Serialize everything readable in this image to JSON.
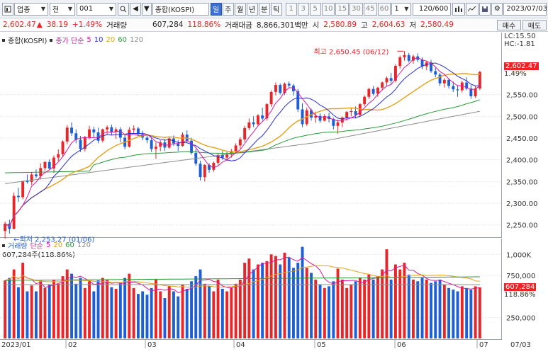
{
  "toolbar": {
    "category": "업종",
    "type": "전",
    "code": "001",
    "name": "종합(KOSPI)",
    "periods": [
      "일",
      "주",
      "월",
      "년",
      "분",
      "틱"
    ],
    "active_period": "일",
    "minutes": [
      "1",
      "3",
      "5",
      "10",
      "15",
      "30",
      "45",
      "60"
    ],
    "unit": "1",
    "count": "120/600",
    "date": "2023/07/03"
  },
  "quote": {
    "price": "2,602.47",
    "change": "38.19",
    "rate": "+1.49%",
    "volume_label": "거래량",
    "volume": "607,284",
    "volume_rate": "118.86%",
    "amount_label": "거래대금",
    "amount": "8,866,301백만",
    "open_label": "시",
    "open": "2,580.89",
    "high_label": "고",
    "high": "2,604.63",
    "low_label": "저",
    "low": "2,580.49",
    "buy": "매수",
    "sell": "매도"
  },
  "price_panel": {
    "title": "종합(KOSPI)",
    "ma_label": "종가 단순",
    "ma_periods": [
      "5",
      "10",
      "20",
      "60",
      "120"
    ],
    "lc": "LC:15.50",
    "hc": "HC:-1.81",
    "last_price": "2,602.47",
    "last_rate": "1.49%",
    "high_annotation": "최고 2,650.45 (06/12)",
    "low_annotation": "최저 2,253.27 (01/06)",
    "y_ticks": [
      "2,550.00",
      "2,500.00",
      "2,450.00",
      "2,400.00",
      "2,350.00",
      "2,300.00",
      "2,250.00"
    ]
  },
  "volume_panel": {
    "title": "거래량",
    "ma_label": "단순",
    "ma_periods": [
      "5",
      "20",
      "60",
      "120"
    ],
    "last_value_text": "607,284주(118.86%)",
    "tag_value": "607,284",
    "tag_rate": "118.86%",
    "y_ticks": [
      "1,000K",
      "750,000",
      "250,000"
    ]
  },
  "x_labels": [
    "2023/01",
    "02",
    "03",
    "04",
    "05",
    "06",
    "07",
    "07/03"
  ],
  "colors": {
    "up": "#e8262a",
    "down": "#1f5fd6",
    "ma5": "#d81b9c",
    "ma10": "#2a2fd0",
    "ma20": "#e3a21a",
    "ma60": "#2a9a3a",
    "ma120": "#8c8c8c"
  },
  "chart_data": {
    "type": "candlestick",
    "title": "종합(KOSPI)",
    "y_range": [
      2230,
      2670
    ],
    "volume_range": [
      0,
      1120000
    ],
    "series_key": [
      "o",
      "h",
      "l",
      "c",
      "v"
    ],
    "candles": [
      [
        2236,
        2258,
        2218,
        2253,
        690000
      ],
      [
        2253,
        2262,
        2230,
        2241,
        720000
      ],
      [
        2241,
        2325,
        2240,
        2317,
        820000
      ],
      [
        2317,
        2336,
        2303,
        2314,
        610000
      ],
      [
        2314,
        2352,
        2309,
        2351,
        900000
      ],
      [
        2351,
        2366,
        2345,
        2349,
        560000
      ],
      [
        2349,
        2372,
        2342,
        2366,
        630000
      ],
      [
        2366,
        2378,
        2358,
        2362,
        560000
      ],
      [
        2362,
        2392,
        2355,
        2381,
        680000
      ],
      [
        2381,
        2397,
        2375,
        2395,
        600000
      ],
      [
        2395,
        2401,
        2376,
        2380,
        640000
      ],
      [
        2380,
        2410,
        2370,
        2405,
        700000
      ],
      [
        2405,
        2424,
        2397,
        2413,
        650000
      ],
      [
        2413,
        2445,
        2408,
        2442,
        740000
      ],
      [
        2442,
        2480,
        2436,
        2474,
        820000
      ],
      [
        2474,
        2486,
        2455,
        2461,
        770000
      ],
      [
        2461,
        2470,
        2438,
        2446,
        650000
      ],
      [
        2446,
        2455,
        2418,
        2425,
        720000
      ],
      [
        2425,
        2455,
        2419,
        2452,
        600000
      ],
      [
        2452,
        2478,
        2447,
        2470,
        680000
      ],
      [
        2470,
        2476,
        2451,
        2463,
        560000
      ],
      [
        2463,
        2474,
        2438,
        2444,
        690000
      ],
      [
        2444,
        2472,
        2440,
        2470,
        720000
      ],
      [
        2470,
        2479,
        2458,
        2475,
        700000
      ],
      [
        2475,
        2481,
        2456,
        2464,
        610000
      ],
      [
        2464,
        2475,
        2448,
        2470,
        590000
      ],
      [
        2470,
        2475,
        2440,
        2451,
        660000
      ],
      [
        2451,
        2460,
        2424,
        2430,
        720000
      ],
      [
        2430,
        2475,
        2428,
        2469,
        770000
      ],
      [
        2469,
        2479,
        2462,
        2472,
        600000
      ],
      [
        2472,
        2476,
        2455,
        2459,
        530000
      ],
      [
        2459,
        2467,
        2445,
        2451,
        560000
      ],
      [
        2451,
        2458,
        2438,
        2445,
        520000
      ],
      [
        2445,
        2451,
        2418,
        2425,
        600000
      ],
      [
        2425,
        2440,
        2402,
        2430,
        700000
      ],
      [
        2430,
        2445,
        2420,
        2440,
        560000
      ],
      [
        2440,
        2448,
        2420,
        2428,
        480000
      ],
      [
        2428,
        2453,
        2425,
        2449,
        620000
      ],
      [
        2449,
        2456,
        2432,
        2438,
        560000
      ],
      [
        2438,
        2445,
        2420,
        2432,
        500000
      ],
      [
        2432,
        2463,
        2430,
        2458,
        640000
      ],
      [
        2458,
        2468,
        2440,
        2444,
        590000
      ],
      [
        2444,
        2451,
        2412,
        2416,
        680000
      ],
      [
        2416,
        2425,
        2386,
        2391,
        740000
      ],
      [
        2391,
        2398,
        2352,
        2360,
        820000
      ],
      [
        2360,
        2390,
        2350,
        2388,
        650000
      ],
      [
        2388,
        2392,
        2370,
        2377,
        620000
      ],
      [
        2377,
        2396,
        2372,
        2393,
        560000
      ],
      [
        2393,
        2415,
        2388,
        2411,
        700000
      ],
      [
        2411,
        2420,
        2400,
        2405,
        590000
      ],
      [
        2405,
        2418,
        2398,
        2412,
        560000
      ],
      [
        2412,
        2425,
        2405,
        2420,
        600000
      ],
      [
        2420,
        2438,
        2415,
        2433,
        650000
      ],
      [
        2433,
        2452,
        2426,
        2447,
        700000
      ],
      [
        2447,
        2478,
        2441,
        2473,
        900000
      ],
      [
        2473,
        2495,
        2468,
        2486,
        950000
      ],
      [
        2486,
        2500,
        2475,
        2482,
        820000
      ],
      [
        2482,
        2505,
        2478,
        2502,
        880000
      ],
      [
        2502,
        2520,
        2490,
        2495,
        900000
      ],
      [
        2495,
        2530,
        2490,
        2528,
        920000
      ],
      [
        2528,
        2560,
        2522,
        2556,
        1000000
      ],
      [
        2556,
        2578,
        2548,
        2572,
        980000
      ],
      [
        2572,
        2576,
        2550,
        2554,
        880000
      ],
      [
        2554,
        2578,
        2549,
        2575,
        1020000
      ],
      [
        2575,
        2580,
        2565,
        2571,
        960000
      ],
      [
        2571,
        2575,
        2548,
        2558,
        840000
      ],
      [
        2558,
        2563,
        2510,
        2516,
        900000
      ],
      [
        2516,
        2530,
        2475,
        2482,
        1090000
      ],
      [
        2482,
        2520,
        2478,
        2514,
        840000
      ],
      [
        2514,
        2518,
        2490,
        2497,
        780000
      ],
      [
        2497,
        2511,
        2485,
        2501,
        700000
      ],
      [
        2501,
        2507,
        2485,
        2490,
        640000
      ],
      [
        2490,
        2505,
        2488,
        2500,
        600000
      ],
      [
        2500,
        2508,
        2486,
        2494,
        620000
      ],
      [
        2494,
        2497,
        2470,
        2478,
        680000
      ],
      [
        2478,
        2492,
        2460,
        2486,
        830000
      ],
      [
        2486,
        2500,
        2475,
        2497,
        700000
      ],
      [
        2497,
        2512,
        2490,
        2510,
        600000
      ],
      [
        2510,
        2520,
        2500,
        2512,
        640000
      ],
      [
        2512,
        2523,
        2495,
        2503,
        680000
      ],
      [
        2503,
        2530,
        2500,
        2528,
        720000
      ],
      [
        2528,
        2548,
        2523,
        2545,
        700000
      ],
      [
        2545,
        2566,
        2540,
        2563,
        760000
      ],
      [
        2563,
        2570,
        2548,
        2552,
        700000
      ],
      [
        2552,
        2568,
        2545,
        2566,
        740000
      ],
      [
        2566,
        2580,
        2560,
        2578,
        820000
      ],
      [
        2578,
        2592,
        2570,
        2588,
        1060000
      ],
      [
        2588,
        2600,
        2575,
        2582,
        700000
      ],
      [
        2582,
        2620,
        2578,
        2616,
        880000
      ],
      [
        2616,
        2640,
        2610,
        2636,
        820000
      ],
      [
        2636,
        2650,
        2628,
        2641,
        900000
      ],
      [
        2641,
        2646,
        2624,
        2628,
        760000
      ],
      [
        2628,
        2642,
        2621,
        2638,
        700000
      ],
      [
        2638,
        2645,
        2625,
        2630,
        680000
      ],
      [
        2630,
        2636,
        2608,
        2615,
        720000
      ],
      [
        2615,
        2628,
        2606,
        2624,
        700000
      ],
      [
        2624,
        2630,
        2600,
        2604,
        660000
      ],
      [
        2604,
        2612,
        2590,
        2596,
        680000
      ],
      [
        2596,
        2600,
        2570,
        2576,
        700000
      ],
      [
        2576,
        2588,
        2566,
        2584,
        640000
      ],
      [
        2584,
        2588,
        2564,
        2570,
        600000
      ],
      [
        2570,
        2580,
        2556,
        2562,
        580000
      ],
      [
        2562,
        2572,
        2545,
        2560,
        560000
      ],
      [
        2560,
        2582,
        2555,
        2578,
        620000
      ],
      [
        2578,
        2590,
        2560,
        2564,
        600000
      ],
      [
        2564,
        2572,
        2540,
        2546,
        580000
      ],
      [
        2546,
        2570,
        2542,
        2564,
        620000
      ],
      [
        2564,
        2605,
        2560,
        2602,
        607284
      ]
    ]
  }
}
